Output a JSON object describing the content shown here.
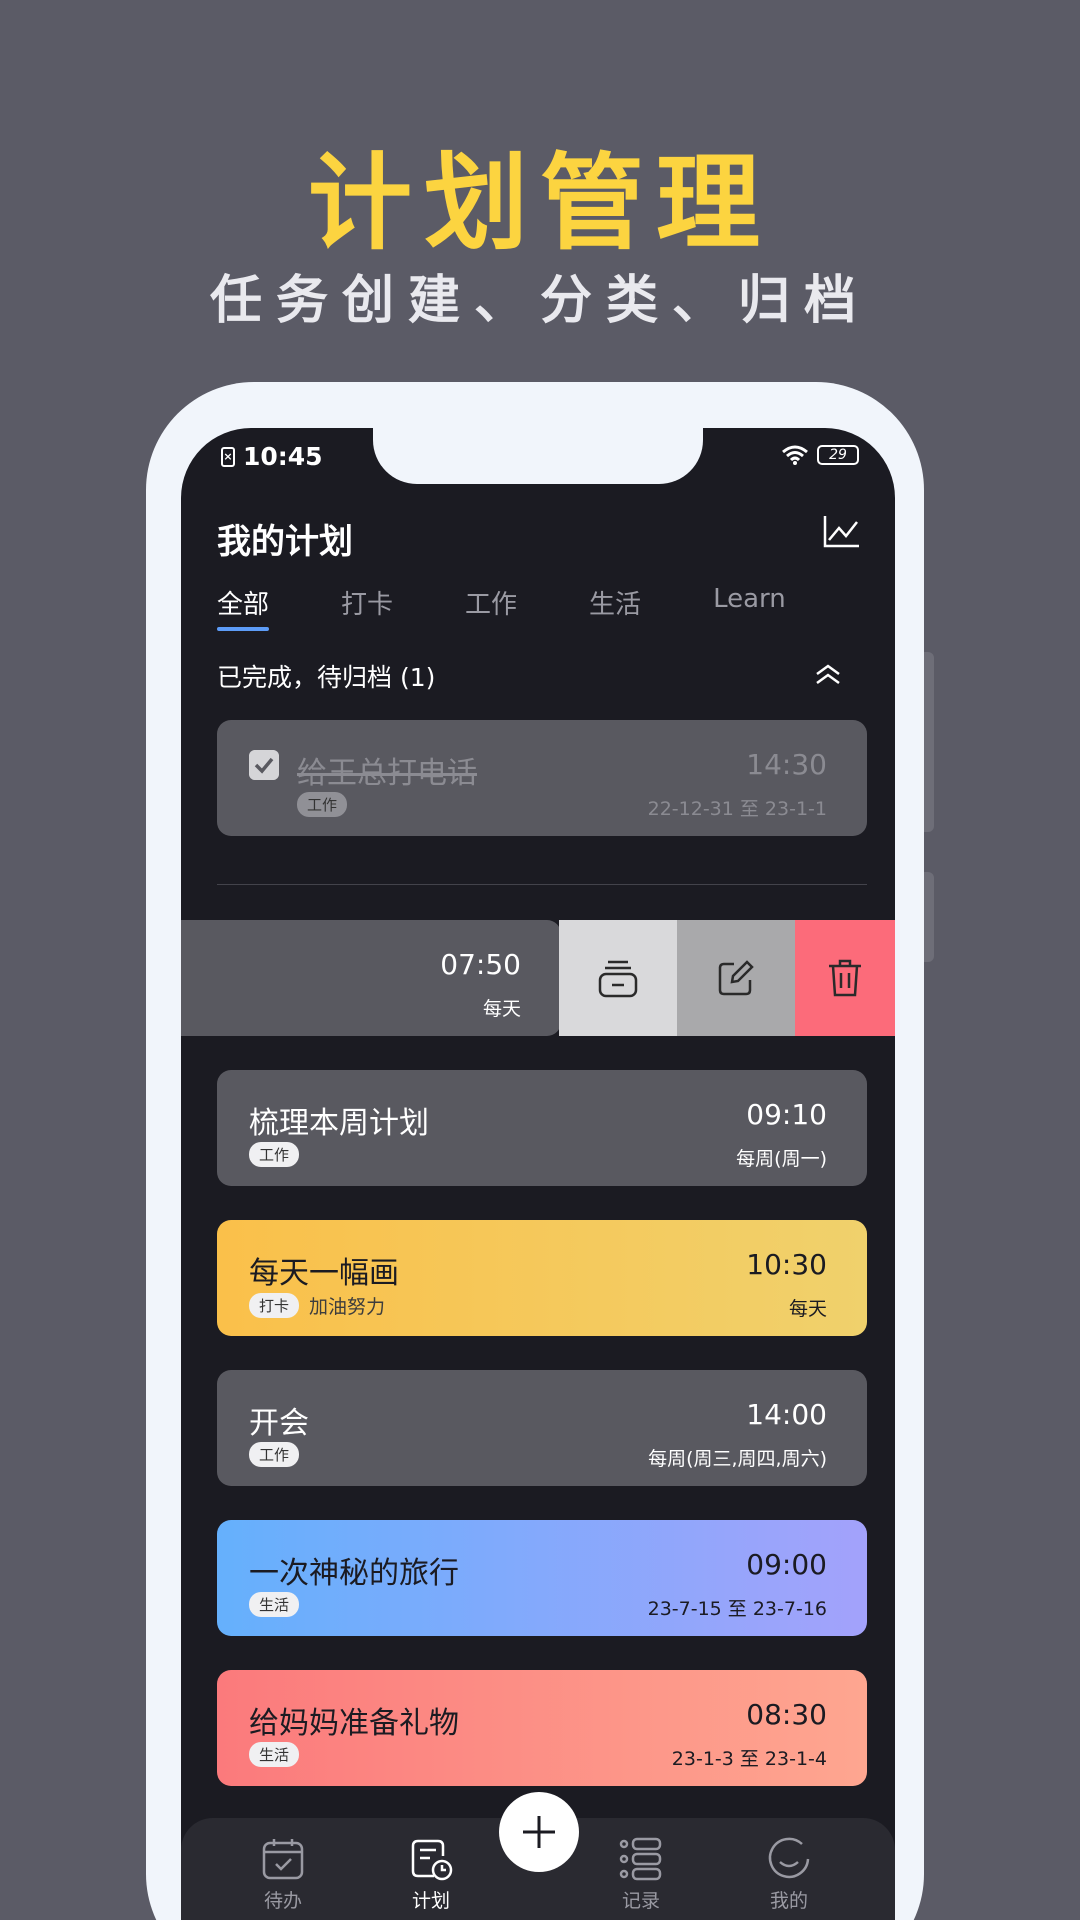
{
  "hero": {
    "title": "计划管理",
    "subtitle": "任务创建、分类、归档"
  },
  "status": {
    "time": "10:45",
    "sim": "×",
    "battery": "29"
  },
  "header": {
    "title": "我的计划"
  },
  "tabs": [
    "全部",
    "打卡",
    "工作",
    "生活",
    "Learn"
  ],
  "completed": {
    "label": "已完成，待归档 (1)",
    "item": {
      "title": "给王总打电话",
      "tag": "工作",
      "time": "14:30",
      "date": "22-12-31 至 23-1-1"
    }
  },
  "swiped": {
    "time": "07:50",
    "repeat": "每天"
  },
  "plans": [
    {
      "title": "梳理本周计划",
      "tag": "工作",
      "note": "",
      "time": "09:10",
      "repeat": "每周(周一)"
    },
    {
      "title": "每天一幅画",
      "tag": "打卡",
      "note": "加油努力",
      "time": "10:30",
      "repeat": "每天"
    },
    {
      "title": "开会",
      "tag": "工作",
      "note": "",
      "time": "14:00",
      "repeat": "每周(周三,周四,周六)"
    },
    {
      "title": "一次神秘的旅行",
      "tag": "生活",
      "note": "",
      "time": "09:00",
      "repeat": "23-7-15 至 23-7-16"
    },
    {
      "title": "给妈妈准备礼物",
      "tag": "生活",
      "note": "",
      "time": "08:30",
      "repeat": "23-1-3 至 23-1-4"
    }
  ],
  "nav": {
    "todo": "待办",
    "plan": "计划",
    "record": "记录",
    "me": "我的"
  },
  "colors": {
    "accent": "#fcd440",
    "tab_underline": "#5d9cf7",
    "delete": "#fc6b7a"
  }
}
